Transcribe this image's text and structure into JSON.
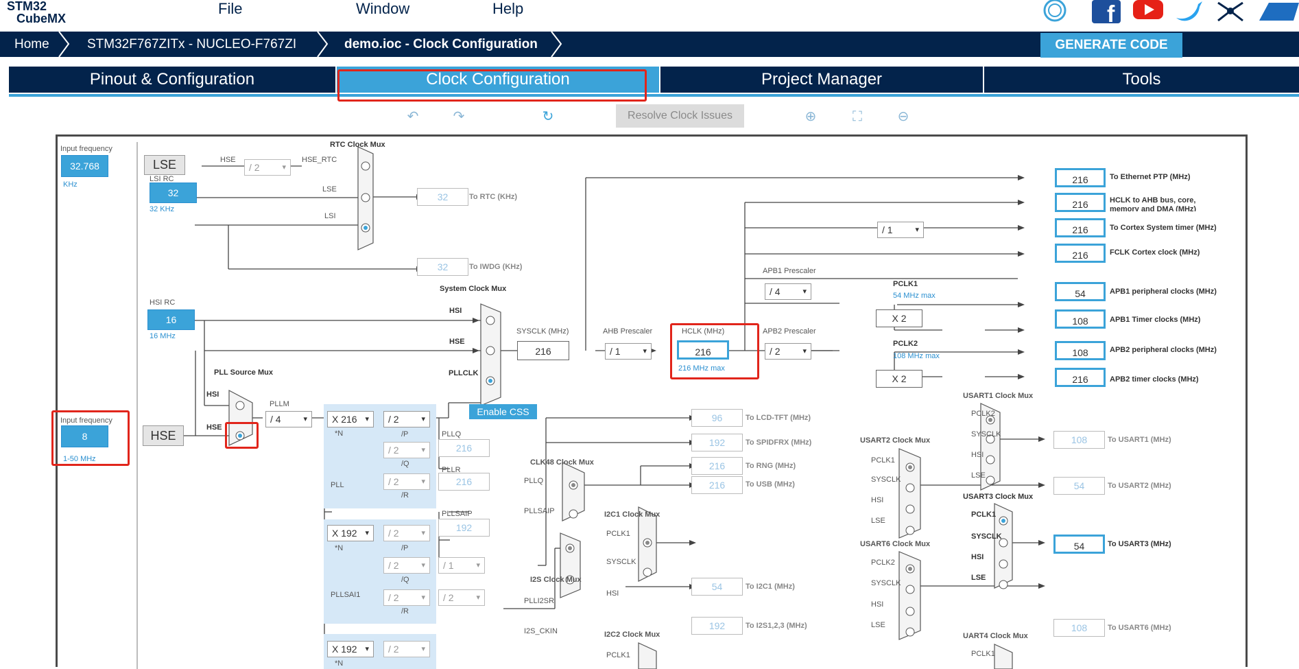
{
  "app": {
    "logo_line1": "STM32",
    "logo_line2": "CubeMX"
  },
  "menu": {
    "file": "File",
    "window": "Window",
    "help": "Help"
  },
  "breadcrumb": {
    "home": "Home",
    "device": "STM32F767ZITx  -  NUCLEO-F767ZI",
    "file": "demo.ioc - Clock Configuration"
  },
  "generate_label": "GENERATE CODE",
  "tabs": [
    "Pinout & Configuration",
    "Clock Configuration",
    "Project Manager",
    "Tools"
  ],
  "toolbar": {
    "resolve": "Resolve Clock Issues"
  },
  "diagram": {
    "input_freq_label": "Input frequency",
    "lse_value": "32.768",
    "lse_unit": "KHz",
    "lse": "LSE",
    "lsi_rc": "LSI RC",
    "lsi_value": "32",
    "lsi_unit": "32 KHz",
    "hsi_rc": "HSI RC",
    "hsi_value": "16",
    "hsi_unit": "16 MHz",
    "hse_input_label": "Input frequency",
    "hse_value": "8",
    "hse_range": "1-50 MHz",
    "hse": "HSE",
    "rtc_mux": "RTC Clock Mux",
    "hse_lbl": "HSE",
    "hse_div": "/ 2",
    "hse_rtc": "HSE_RTC",
    "lse_lbl": "LSE",
    "lsi_lbl": "LSI",
    "rtc_val": "32",
    "rtc_to": "To RTC (KHz)",
    "iwdg_val": "32",
    "iwdg_to": "To IWDG (KHz)",
    "sys_mux": "System Clock Mux",
    "hsi_in": "HSI",
    "hse_in": "HSE",
    "pllclk": "PLLCLK",
    "enable_css": "Enable CSS",
    "sysclk_label": "SYSCLK (MHz)",
    "sysclk_value": "216",
    "ahb_label": "AHB Prescaler",
    "ahb_value": "/ 1",
    "hclk_label": "HCLK (MHz)",
    "hclk_value": "216",
    "hclk_max": "216 MHz max",
    "apb1_label": "APB1 Prescaler",
    "apb1_value": "/ 4",
    "apb2_label": "APB2 Prescaler",
    "apb2_value": "/ 2",
    "pclk1": "PCLK1",
    "pclk1_max": "54 MHz max",
    "pclk2": "PCLK2",
    "pclk2_max": "108 MHz max",
    "x2": "X 2",
    "cortex_div": "/ 1",
    "pll_src_mux": "PLL Source Mux",
    "pllm_label": "PLLM",
    "pllm_value": "/ 4",
    "pll_n": "X 216",
    "pll_n_lbl": "*N",
    "pll_p": "/ 2",
    "pll_p_lbl": "/P",
    "pll_q": "/ 2",
    "pll_q_lbl": "/Q",
    "pll_r": "/ 2",
    "pll_r_lbl": "/R",
    "pll_lbl": "PLL",
    "pllq": "PLLQ",
    "pllq_val": "216",
    "pllr": "PLLR",
    "pllr_val": "216",
    "plls_n": "X 192",
    "plls_p": "/ 2",
    "plls_q": "/ 2",
    "plls_q2": "/ 1",
    "plls_r": "/ 2",
    "plls_r2": "/ 2",
    "pllsaip": "PLLSAIP",
    "pllsaip_val": "192",
    "pllsai1": "PLLSAI1",
    "plli2s_n": "X 192",
    "plli2s_p": "/ 2",
    "clk48_mux": "CLK48 Clock Mux",
    "pllq_in": "PLLQ",
    "pllsaip_in": "PLLSAIP",
    "i2c1_mux": "I2C1 Clock Mux",
    "i2s_mux": "I2S Clock Mux",
    "plli2sr": "PLLI2SR",
    "i2s_ckin": "I2S_CKIN",
    "i2c2_mux": "I2C2 Clock Mux",
    "pclk1_in": "PCLK1",
    "sysclk_in": "SYSCLK",
    "hsi_in2": "HSI",
    "usart1_mux": "USART1 Clock Mux",
    "usart2_mux": "USART2 Clock Mux",
    "usart3_mux": "USART3 Clock Mux",
    "usart6_mux": "USART6 Clock Mux",
    "uart4_mux": "UART4 Clock Mux",
    "pclk2_in": "PCLK2",
    "lse_in": "LSE",
    "outputs": [
      {
        "value": "216",
        "label": "To Ethernet PTP (MHz)"
      },
      {
        "value": "216",
        "label": "HCLK to AHB bus, core, memory and DMA (MHz)"
      },
      {
        "value": "216",
        "label": "To Cortex System timer (MHz)"
      },
      {
        "value": "216",
        "label": "FCLK Cortex clock (MHz)"
      },
      {
        "value": "54",
        "label": "APB1 peripheral clocks (MHz)"
      },
      {
        "value": "108",
        "label": "APB1 Timer clocks (MHz)"
      },
      {
        "value": "108",
        "label": "APB2 peripheral clocks (MHz)"
      },
      {
        "value": "216",
        "label": "APB2 timer clocks (MHz)"
      }
    ],
    "lcd_val": "96",
    "lcd_to": "To LCD-TFT (MHz)",
    "spdif_val": "192",
    "spdif_to": "To SPIDFRX (MHz)",
    "rng_val": "216",
    "rng_to": "To RNG (MHz)",
    "usb_val": "216",
    "usb_to": "To USB (MHz)",
    "i2c1_val": "54",
    "i2c1_to": "To I2C1 (MHz)",
    "i2s_val": "192",
    "i2s_to": "To I2S1,2,3 (MHz)",
    "usart1_val": "108",
    "usart1_to": "To USART1 (MHz)",
    "usart2_val": "54",
    "usart2_to": "To USART2 (MHz)",
    "usart3_val": "54",
    "usart3_to": "To USART3 (MHz)",
    "usart6_val": "108",
    "usart6_to": "To USART6 (MHz)"
  }
}
